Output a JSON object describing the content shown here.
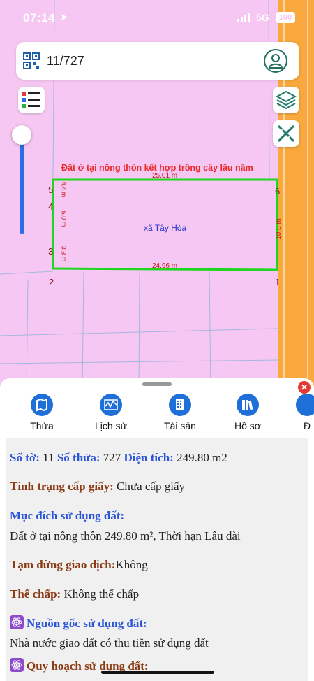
{
  "status_bar": {
    "time": "07:14",
    "network": "5G",
    "battery": "100"
  },
  "search": {
    "value": "11/727"
  },
  "map": {
    "land_use_label": "Đất ở tại nông thôn kết hợp trồng cây lâu năm",
    "commune": "xã Tây Hòa",
    "dimensions": {
      "top": "25.01 m",
      "bottom": "24.96 m",
      "right": "10.0 m",
      "left_upper": "4.4 m",
      "left_mid": "5.0 m",
      "left_lower": "3.3 m"
    },
    "points": [
      "1",
      "2",
      "3",
      "4",
      "5",
      "6"
    ],
    "colors": {
      "parcel_border": "#1fd61f",
      "land_pink": "#f7c7f3",
      "road_orange": "#f8a83c"
    }
  },
  "tabs": [
    {
      "label": "Thửa",
      "icon": "map-icon"
    },
    {
      "label": "Lịch sử",
      "icon": "chart-icon"
    },
    {
      "label": "Tài sản",
      "icon": "building-icon"
    },
    {
      "label": "Hồ sơ",
      "icon": "books-icon"
    },
    {
      "label": "Đ",
      "icon": "more-icon"
    }
  ],
  "details": {
    "so_to_label": "Số tờ:",
    "so_to": "11",
    "so_thua_label": "Số thửa:",
    "so_thua": "727",
    "dien_tich_label": "Diện tích:",
    "dien_tich": "249.80 m2",
    "cap_giay_label": "Tình trạng cấp giấy:",
    "cap_giay": "Chưa cấp giấy",
    "muc_dich_label": "Mục đích sử dụng đất:",
    "muc_dich": "Đất ở tại nông thôn 249.80 m², Thời hạn Lâu dài",
    "tam_dung_label": "Tạm dừng giao dịch:",
    "tam_dung": "Không",
    "the_chap_label": "Thế chấp:",
    "the_chap": "Không thế chấp",
    "nguon_goc_label": "Nguồn gốc sử dụng đất:",
    "nguon_goc": "Nhà nước giao đất có thu tiền sử dụng đất",
    "quy_hoach_label": "Quy hoạch sử dụng đất:"
  }
}
